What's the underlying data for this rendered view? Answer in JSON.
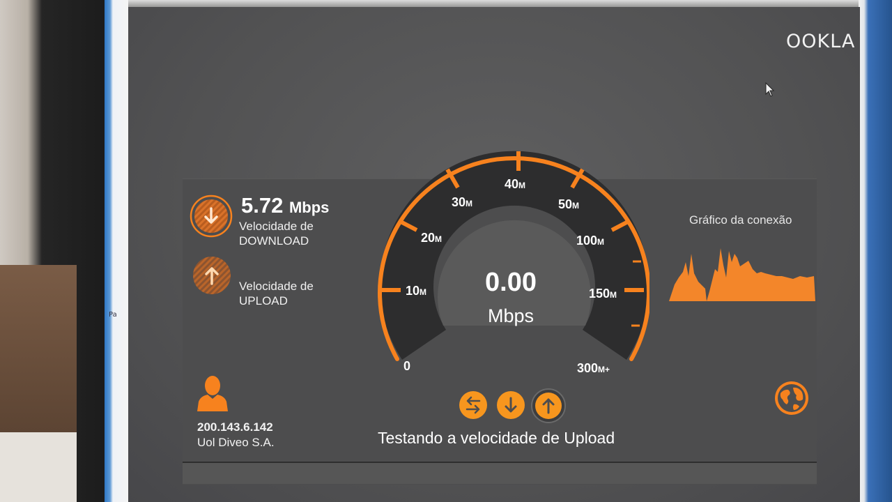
{
  "brand": {
    "logo_text": "OOKLA",
    "accent": "#f7821e"
  },
  "download": {
    "value": "5.72",
    "unit": "Mbps",
    "label_line1": "Velocidade de",
    "label_line2": "DOWNLOAD",
    "icon": "arrow-down-icon"
  },
  "upload": {
    "label_line1": "Velocidade de",
    "label_line2": "UPLOAD",
    "icon": "arrow-up-icon"
  },
  "gauge": {
    "current_value": "0.00",
    "current_unit": "Mbps",
    "ticks": [
      {
        "num": "0",
        "suffix": ""
      },
      {
        "num": "10",
        "suffix": "M"
      },
      {
        "num": "20",
        "suffix": "M"
      },
      {
        "num": "30",
        "suffix": "M"
      },
      {
        "num": "40",
        "suffix": "M"
      },
      {
        "num": "50",
        "suffix": "M"
      },
      {
        "num": "100",
        "suffix": "M"
      },
      {
        "num": "150",
        "suffix": "M"
      },
      {
        "num": "300",
        "suffix": "M+"
      }
    ]
  },
  "connection_graph": {
    "title": "Gráfico da conexão"
  },
  "client": {
    "ip": "200.143.6.142",
    "isp": "Uol Diveo S.A.",
    "icon": "user-icon"
  },
  "controls": {
    "status_text": "Testando a velocidade de Upload",
    "buttons": [
      "swap-arrows-icon",
      "arrow-down-icon",
      "arrow-up-icon"
    ],
    "globe_icon": "globe-icon"
  },
  "os": {
    "taskbar_text": "Pa"
  }
}
